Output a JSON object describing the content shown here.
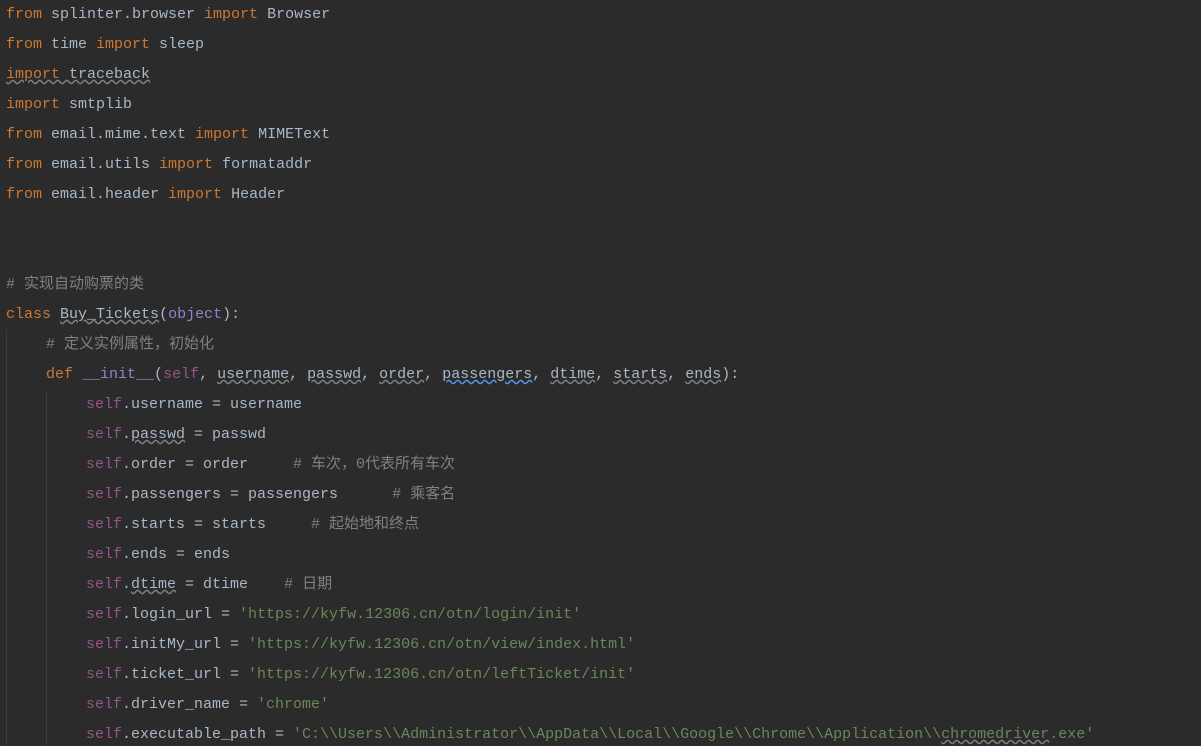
{
  "lines": [
    {
      "segments": [
        {
          "cls": "kw",
          "t": "from"
        },
        {
          "cls": "pln",
          "t": " splinter.browser "
        },
        {
          "cls": "kw",
          "t": "import"
        },
        {
          "cls": "pln",
          "t": " Browser"
        }
      ]
    },
    {
      "segments": [
        {
          "cls": "kw",
          "t": "from"
        },
        {
          "cls": "pln",
          "t": " time "
        },
        {
          "cls": "kw",
          "t": "import"
        },
        {
          "cls": "pln",
          "t": " sleep"
        }
      ]
    },
    {
      "segments": [
        {
          "cls": "kw und",
          "t": "import"
        },
        {
          "cls": "pln und",
          "t": " traceback"
        }
      ]
    },
    {
      "segments": [
        {
          "cls": "kw",
          "t": "import"
        },
        {
          "cls": "pln",
          "t": " smtplib"
        }
      ]
    },
    {
      "segments": [
        {
          "cls": "kw",
          "t": "from"
        },
        {
          "cls": "pln",
          "t": " email.mime.text "
        },
        {
          "cls": "kw",
          "t": "import"
        },
        {
          "cls": "pln",
          "t": " MIMEText"
        }
      ]
    },
    {
      "segments": [
        {
          "cls": "kw",
          "t": "from"
        },
        {
          "cls": "pln",
          "t": " email.utils "
        },
        {
          "cls": "kw",
          "t": "import"
        },
        {
          "cls": "pln",
          "t": " formataddr"
        }
      ]
    },
    {
      "segments": [
        {
          "cls": "kw",
          "t": "from"
        },
        {
          "cls": "pln",
          "t": " email.header "
        },
        {
          "cls": "kw",
          "t": "import"
        },
        {
          "cls": "pln",
          "t": " Header"
        }
      ]
    },
    {
      "segments": []
    },
    {
      "segments": []
    },
    {
      "segments": [
        {
          "cls": "cmt",
          "t": "# 实现自动购票的类"
        }
      ]
    },
    {
      "segments": [
        {
          "cls": "kw",
          "t": "class"
        },
        {
          "cls": "pln",
          "t": " "
        },
        {
          "cls": "pln und",
          "t": "Buy_Tickets"
        },
        {
          "cls": "pln",
          "t": "("
        },
        {
          "cls": "builtin",
          "t": "object"
        },
        {
          "cls": "pln",
          "t": "):"
        }
      ]
    },
    {
      "indent": 1,
      "segments": [
        {
          "cls": "cmt",
          "t": "# 定义实例属性，初始化"
        }
      ]
    },
    {
      "indent": 1,
      "segments": [
        {
          "cls": "kw",
          "t": "def"
        },
        {
          "cls": "pln",
          "t": " "
        },
        {
          "cls": "builtin",
          "t": "__init__"
        },
        {
          "cls": "pln",
          "t": "("
        },
        {
          "cls": "self",
          "t": "self"
        },
        {
          "cls": "pln",
          "t": ", "
        },
        {
          "cls": "param und",
          "t": "username"
        },
        {
          "cls": "pln",
          "t": ", "
        },
        {
          "cls": "param und",
          "t": "passwd"
        },
        {
          "cls": "pln",
          "t": ", "
        },
        {
          "cls": "param und",
          "t": "order"
        },
        {
          "cls": "pln",
          "t": ", "
        },
        {
          "cls": "param und-blue",
          "t": "passengers"
        },
        {
          "cls": "pln",
          "t": ", "
        },
        {
          "cls": "param und",
          "t": "dtime"
        },
        {
          "cls": "pln",
          "t": ", "
        },
        {
          "cls": "param und",
          "t": "starts"
        },
        {
          "cls": "pln",
          "t": ", "
        },
        {
          "cls": "param und",
          "t": "ends"
        },
        {
          "cls": "pln",
          "t": "):"
        }
      ]
    },
    {
      "indent": 2,
      "segments": [
        {
          "cls": "self",
          "t": "self"
        },
        {
          "cls": "pln",
          "t": ".username = username"
        }
      ]
    },
    {
      "indent": 2,
      "segments": [
        {
          "cls": "self",
          "t": "self"
        },
        {
          "cls": "pln",
          "t": "."
        },
        {
          "cls": "pln und",
          "t": "passwd"
        },
        {
          "cls": "pln",
          "t": " = passwd"
        }
      ]
    },
    {
      "indent": 2,
      "segments": [
        {
          "cls": "self",
          "t": "self"
        },
        {
          "cls": "pln",
          "t": ".order = order     "
        },
        {
          "cls": "cmt",
          "t": "# 车次，0代表所有车次"
        }
      ]
    },
    {
      "indent": 2,
      "segments": [
        {
          "cls": "self",
          "t": "self"
        },
        {
          "cls": "pln",
          "t": ".passengers = passengers      "
        },
        {
          "cls": "cmt",
          "t": "# 乘客名"
        }
      ]
    },
    {
      "indent": 2,
      "segments": [
        {
          "cls": "self",
          "t": "self"
        },
        {
          "cls": "pln",
          "t": ".starts = starts     "
        },
        {
          "cls": "cmt",
          "t": "# 起始地和终点"
        }
      ]
    },
    {
      "indent": 2,
      "segments": [
        {
          "cls": "self",
          "t": "self"
        },
        {
          "cls": "pln",
          "t": ".ends = ends"
        }
      ]
    },
    {
      "indent": 2,
      "segments": [
        {
          "cls": "self",
          "t": "self"
        },
        {
          "cls": "pln",
          "t": "."
        },
        {
          "cls": "pln und",
          "t": "dtime"
        },
        {
          "cls": "pln",
          "t": " = dtime    "
        },
        {
          "cls": "cmt",
          "t": "# 日期"
        }
      ]
    },
    {
      "indent": 2,
      "segments": [
        {
          "cls": "self",
          "t": "self"
        },
        {
          "cls": "pln",
          "t": ".login_url = "
        },
        {
          "cls": "str",
          "t": "'https://kyfw.12306.cn/otn/login/init'"
        }
      ]
    },
    {
      "indent": 2,
      "segments": [
        {
          "cls": "self",
          "t": "self"
        },
        {
          "cls": "pln",
          "t": ".initMy_url = "
        },
        {
          "cls": "str",
          "t": "'https://kyfw.12306.cn/otn/view/index.html'"
        }
      ]
    },
    {
      "indent": 2,
      "segments": [
        {
          "cls": "self",
          "t": "self"
        },
        {
          "cls": "pln",
          "t": ".ticket_url = "
        },
        {
          "cls": "str",
          "t": "'https://kyfw.12306.cn/otn/leftTicket/init'"
        }
      ]
    },
    {
      "indent": 2,
      "segments": [
        {
          "cls": "self",
          "t": "self"
        },
        {
          "cls": "pln",
          "t": ".driver_name = "
        },
        {
          "cls": "str",
          "t": "'chrome'"
        }
      ]
    },
    {
      "indent": 2,
      "segments": [
        {
          "cls": "self",
          "t": "self"
        },
        {
          "cls": "pln",
          "t": ".executable_path = "
        },
        {
          "cls": "str",
          "t": "'C:\\\\Users\\\\Administrator\\\\AppData\\\\Local\\\\Google\\\\Chrome\\\\Application\\\\"
        },
        {
          "cls": "str und",
          "t": "chromedriver"
        },
        {
          "cls": "str",
          "t": ".exe'"
        }
      ]
    }
  ]
}
